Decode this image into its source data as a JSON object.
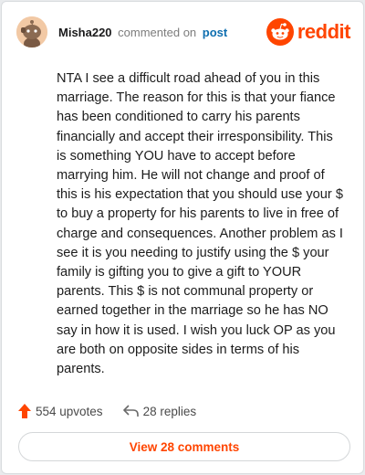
{
  "comment": {
    "username": "Misha220",
    "commented_on": "commented on",
    "post_link": "post",
    "body": "NTA I see a difficult road ahead of you in this marriage. The reason for this is that your fiance has been conditioned to carry his parents financially and accept their irresponsibility. This is something YOU have to accept before marrying him. He will not change and proof of this is his expectation that you should use your $ to buy a property for his parents to live in free of charge and consequences. Another problem as I see it is you needing to justify using the $ your family is gifting you to give a gift to YOUR parents. This $ is not communal property or earned together in the marriage so he has NO say in how it is used. I wish you luck OP as you are both on opposite sides in terms of his parents.",
    "upvotes": "554 upvotes",
    "replies": "28 replies",
    "view_comments": "View 28 comments"
  },
  "brand": {
    "wordmark": "reddit",
    "color": "#ff4500"
  },
  "icons": {
    "avatar": "snoo-avatar-icon",
    "logo": "reddit-logo-icon",
    "upvote": "upvote-arrow-icon",
    "reply": "reply-arrow-icon"
  },
  "colors": {
    "accent": "#ff4500",
    "link": "#0f6fb0",
    "muted": "#7c7c7c"
  }
}
